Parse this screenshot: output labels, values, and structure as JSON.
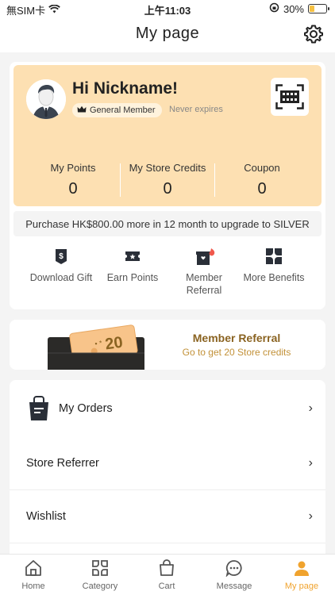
{
  "status_bar": {
    "carrier": "無SIM卡",
    "time": "上午11:03",
    "battery": "30%",
    "battery_level": 0.3
  },
  "header": {
    "title": "My page",
    "settings_icon": "gear-icon"
  },
  "member": {
    "greeting": "Hi Nickname!",
    "tier": "General Member",
    "expiry": "Never expires",
    "qr_icon": "barcode-scan-icon",
    "stats": [
      {
        "label": "My Points",
        "value": "0"
      },
      {
        "label": "My Store Credits",
        "value": "0"
      },
      {
        "label": "Coupon",
        "value": "0"
      }
    ],
    "upgrade_text": "Purchase HK$800.00 more in 12 month to upgrade to SILVER"
  },
  "quick_actions": [
    {
      "label": "Download Gift",
      "icon": "gift-icon"
    },
    {
      "label": "Earn Points",
      "icon": "ticket-icon"
    },
    {
      "label": "Member Referral",
      "icon": "referral-gift-icon"
    },
    {
      "label": "More Benefits",
      "icon": "benefits-grid-icon"
    }
  ],
  "promo": {
    "title": "Member Referral",
    "subtitle": "Go to get 20 Store credits",
    "ticket_value": "20"
  },
  "menu": {
    "items": [
      {
        "label": "My Orders",
        "icon": "shopping-bag-icon"
      },
      {
        "label": "Store Referrer"
      },
      {
        "label": "Wishlist"
      }
    ]
  },
  "tabs": [
    {
      "label": "Home",
      "icon": "home-icon"
    },
    {
      "label": "Category",
      "icon": "category-icon"
    },
    {
      "label": "Cart",
      "icon": "cart-icon"
    },
    {
      "label": "Message",
      "icon": "message-icon"
    },
    {
      "label": "My page",
      "icon": "user-icon",
      "active": true
    }
  ],
  "colors": {
    "accent": "#f0a32e",
    "card_bg": "#fde0b2",
    "promo_title": "#8a6321",
    "promo_sub": "#c29138"
  }
}
